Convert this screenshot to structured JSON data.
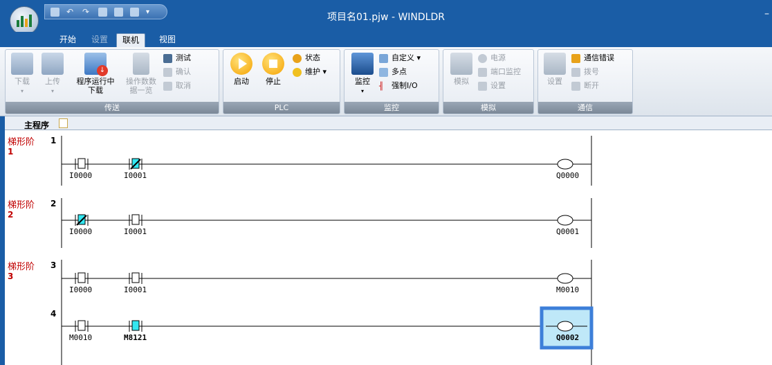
{
  "window": {
    "title": "项目名01.pjw - WINDLDR",
    "close_glyph": "–"
  },
  "menu_tabs": [
    {
      "label": "开始"
    },
    {
      "label": "设置"
    },
    {
      "label": "联机"
    },
    {
      "label": "视图"
    }
  ],
  "ribbon": {
    "transfer": {
      "label": "传送",
      "download": "下载",
      "upload": "上传",
      "run_download": "程序运行中下载",
      "op_data": "操作数数据一览",
      "test": "测试",
      "confirm": "确认",
      "cancel": "取消"
    },
    "plc": {
      "label": "PLC",
      "start": "启动",
      "stop": "停止",
      "status": "状态",
      "maintain": "维护"
    },
    "monitor": {
      "label": "监控",
      "monitor": "监控",
      "custom": "自定义",
      "multi": "多点",
      "force_io": "强制I/O"
    },
    "simulate": {
      "label": "模拟",
      "simulate": "模拟",
      "power": "电源",
      "port_monitor": "端口监控",
      "settings": "设置"
    },
    "comm": {
      "label": "通信",
      "settings": "设置",
      "comm_error": "通信错误",
      "dial": "拨号",
      "disconnect": "断开"
    }
  },
  "doc_tab": {
    "label": "主程序"
  },
  "rungs": [
    {
      "label": "梯形阶",
      "num": "1"
    },
    {
      "label": "梯形阶",
      "num": "2"
    },
    {
      "label": "梯形阶",
      "num": "3"
    }
  ],
  "line_numbers": [
    "1",
    "2",
    "3",
    "4"
  ],
  "operands": {
    "r1a": "I0000",
    "r1b": "I0001",
    "r1c": "Q0000",
    "r2a": "I0000",
    "r2b": "I0001",
    "r2c": "Q0001",
    "r3a": "I0000",
    "r3b": "I0001",
    "r3c": "M0010",
    "r4a": "M0010",
    "r4b": "M8121",
    "r4c": "Q0002"
  },
  "colors": {
    "accent": "#1a5da6",
    "rung_label": "#c00000",
    "contact_on": "#33e6f0",
    "selection": "#3d7fd9"
  }
}
